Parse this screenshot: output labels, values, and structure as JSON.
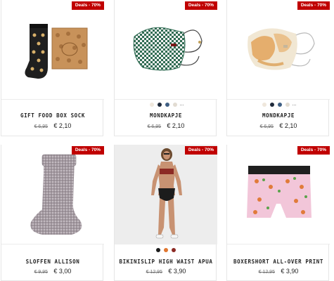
{
  "products": [
    {
      "title": "GIFT FOOD BOX SOCK",
      "old_price": "€ 6,95",
      "new_price": "€ 2,10",
      "badge": "Deals - 70%",
      "image": "socks-and-box",
      "colors": []
    },
    {
      "title": "MONDKAPJE",
      "old_price": "€ 6,95",
      "new_price": "€ 2,10",
      "badge": "Deals - 70%",
      "image": "checkered-face-mask",
      "colors": [
        "#efe7dc",
        "#1f2a3a",
        "#3f5f83",
        "#e2dcd2"
      ],
      "more": "..."
    },
    {
      "title": "MONDKAPJE",
      "old_price": "€ 6,95",
      "new_price": "€ 2,10",
      "badge": "Deals - 70%",
      "image": "tie-dye-face-mask",
      "colors": [
        "#efe7dc",
        "#1f2a3a",
        "#3f5f83",
        "#e2dcd2"
      ],
      "more": "..."
    },
    {
      "title": "SLOFFEN ALLISON",
      "old_price": "€ 9,95",
      "new_price": "€ 3,00",
      "badge": "Deals - 70%",
      "image": "knitted-slipper-sock",
      "colors": []
    },
    {
      "title": "BIKINISLIP HIGH WAIST APUA",
      "old_price": "€ 12,95",
      "new_price": "€ 3,90",
      "badge": "Deals - 70%",
      "image": "model-bikini",
      "colors": [
        "#1c1c1c",
        "#e0762f",
        "#8c2a24"
      ]
    },
    {
      "title": "BOXERSHORT ALL-OVER PRINT",
      "old_price": "€ 12,95",
      "new_price": "€ 3,90",
      "badge": "Deals - 70%",
      "image": "printed-boxershort",
      "colors": []
    }
  ]
}
